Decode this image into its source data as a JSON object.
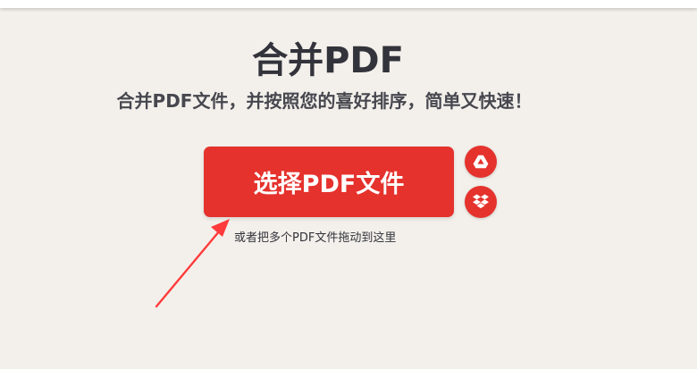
{
  "header": {
    "title": "合并PDF",
    "subtitle": "合并PDF文件，并按照您的喜好排序，简单又快速！"
  },
  "upload": {
    "button_label": "选择PDF文件",
    "drop_hint": "或者把多个PDF文件拖动到这里"
  },
  "cloud_sources": {
    "gdrive_icon": "google-drive-icon",
    "dropbox_icon": "dropbox-icon"
  },
  "colors": {
    "accent": "#e5322d",
    "background": "#f3f0eb",
    "title_text": "#33333b",
    "annotation_arrow": "#ff3b3b"
  }
}
